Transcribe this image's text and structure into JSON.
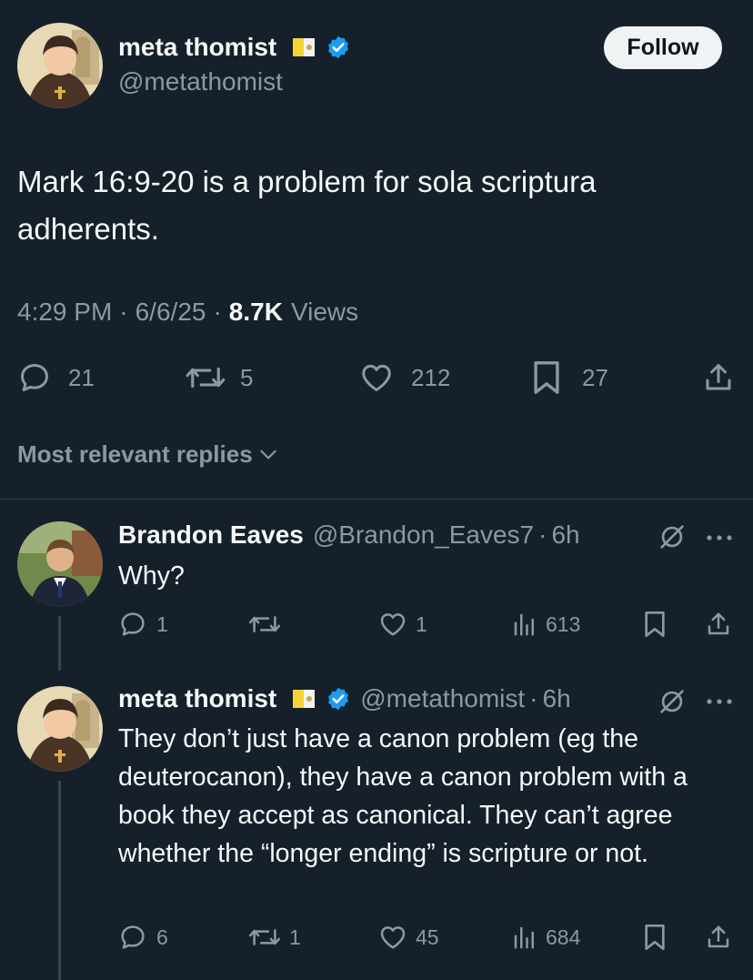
{
  "colors": {
    "background": "#15202b",
    "muted": "#8b98a5",
    "verified": "#1d9bf0",
    "divider": "#38444d",
    "follow_bg": "#eff3f4"
  },
  "main_tweet": {
    "author_name": "meta thomist",
    "handle": "@metathomist",
    "flag_icon": "vatican-flag-icon",
    "verified_icon": "verified-badge-icon",
    "follow_label": "Follow",
    "text": "Mark 16:9-20 is a problem for sola scriptura adherents.",
    "time": "4:29 PM",
    "date": "6/6/25",
    "views_count": "8.7K",
    "views_label": "Views",
    "replies": "21",
    "reposts": "5",
    "likes": "212",
    "bookmarks": "27"
  },
  "replies_sort": {
    "label": "Most relevant replies"
  },
  "replies": [
    {
      "author_name": "Brandon Eaves",
      "handle": "@Brandon_Eaves7",
      "time": "6h",
      "text": "Why?",
      "replies": "1",
      "reposts": "",
      "likes": "1",
      "views": "613"
    },
    {
      "author_name": "meta thomist",
      "handle": "@metathomist",
      "time": "6h",
      "text": "They don’t just have a canon problem (eg the deuterocanon), they have a canon problem with a book they accept as canonical. They can’t agree whether the “longer ending” is scripture or not.",
      "replies": "6",
      "reposts": "1",
      "likes": "45",
      "views": "684"
    }
  ]
}
